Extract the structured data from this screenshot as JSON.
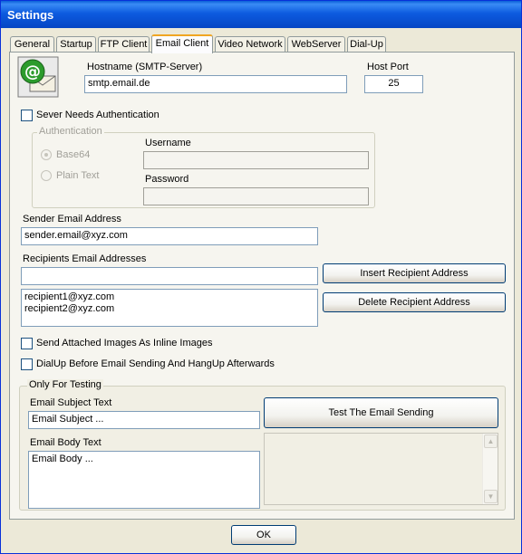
{
  "window": {
    "title": "Settings"
  },
  "tabs": [
    {
      "label": "General"
    },
    {
      "label": "Startup"
    },
    {
      "label": "FTP Client"
    },
    {
      "label": "Email Client"
    },
    {
      "label": "Video Network"
    },
    {
      "label": "WebServer"
    },
    {
      "label": "Dial-Up"
    }
  ],
  "active_tab": "Email Client",
  "icon": "email-at-icon",
  "smtp": {
    "hostname_label": "Hostname (SMTP-Server)",
    "hostname_value": "smtp.email.de",
    "port_label": "Host Port",
    "port_value": "25"
  },
  "auth": {
    "needs_auth_label": "Sever Needs Authentication",
    "needs_auth_checked": false,
    "group_title": "Authentication",
    "base64_label": "Base64",
    "plaintext_label": "Plain Text",
    "username_label": "Username",
    "username_value": "",
    "password_label": "Password",
    "password_value": ""
  },
  "sender": {
    "label": "Sender Email Address",
    "value": "sender.email@xyz.com"
  },
  "recipients": {
    "label": "Recipients Email Addresses",
    "input_value": "",
    "list": [
      "recipient1@xyz.com",
      "recipient2@xyz.com"
    ],
    "insert_label": "Insert Recipient Address",
    "delete_label": "Delete Recipient Address"
  },
  "options": {
    "inline_images_label": "Send Attached Images As Inline Images",
    "dialup_label": "DialUp Before Email Sending And HangUp Afterwards"
  },
  "testing": {
    "group_title": "Only For Testing",
    "subject_label": "Email Subject Text",
    "subject_value": "Email Subject ...",
    "body_label": "Email Body Text",
    "body_value": "Email Body ...",
    "test_button": "Test The Email Sending",
    "output_value": ""
  },
  "footer": {
    "ok_label": "OK"
  },
  "colors": {
    "titlebar": "#0546c4",
    "tab_active_accent": "#f0a622",
    "field_border": "#7f9db9",
    "dialog_bg": "#ece9d8"
  }
}
